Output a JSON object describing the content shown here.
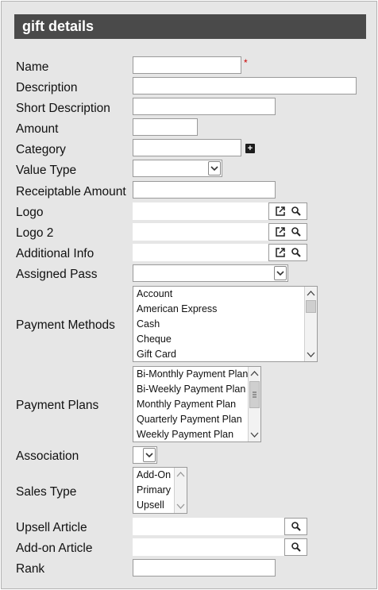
{
  "header": {
    "title": "gift details"
  },
  "labels": {
    "name": "Name",
    "description": "Description",
    "short_description": "Short Description",
    "amount": "Amount",
    "category": "Category",
    "value_type": "Value Type",
    "receiptable_amount": "Receiptable Amount",
    "logo": "Logo",
    "logo2": "Logo 2",
    "additional_info": "Additional Info",
    "assigned_pass": "Assigned Pass",
    "payment_methods": "Payment Methods",
    "payment_plans": "Payment Plans",
    "association": "Association",
    "sales_type": "Sales Type",
    "upsell_article": "Upsell Article",
    "addon_article": "Add-on Article",
    "rank": "Rank"
  },
  "required_marker": "*",
  "category_add": "+",
  "values": {
    "name": "",
    "description": "",
    "short_description": "",
    "amount": "",
    "category": "",
    "value_type": "",
    "receiptable_amount": "",
    "logo": "",
    "logo2": "",
    "additional_info": "",
    "assigned_pass": "",
    "association": "",
    "upsell_article": "",
    "addon_article": "",
    "rank": ""
  },
  "payment_methods": [
    "Account",
    "American Express",
    "Cash",
    "Cheque",
    "Gift Card"
  ],
  "payment_plans": [
    "Bi-Monthly Payment Plan",
    "Bi-Weekly Payment Plan",
    "Monthly Payment Plan",
    "Quarterly Payment Plan",
    "Weekly Payment Plan"
  ],
  "sales_types": [
    "Add-On",
    "Primary",
    "Upsell"
  ],
  "icons": {
    "open": "external-link-icon",
    "search": "magnifier-icon",
    "add": "plus-square-icon",
    "dropdown": "chevron-down-icon"
  }
}
